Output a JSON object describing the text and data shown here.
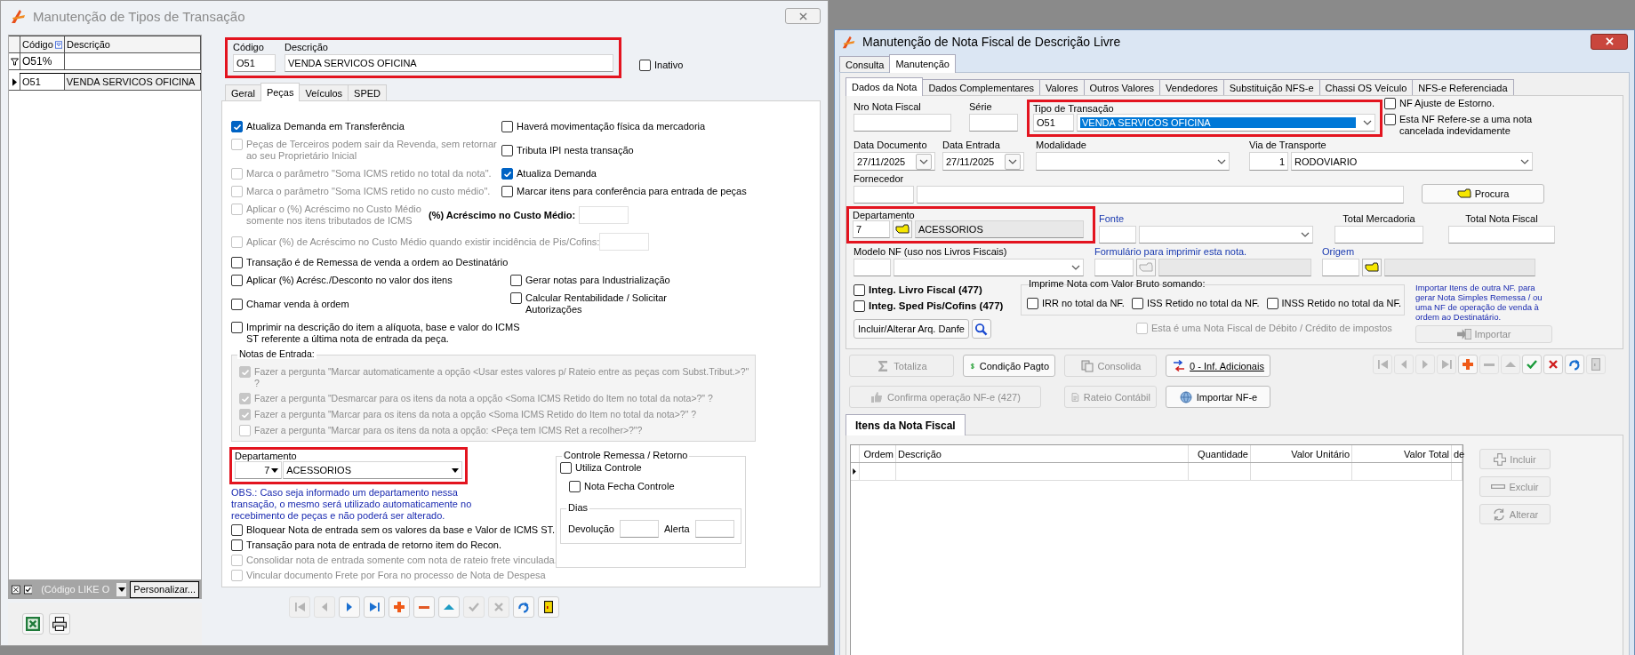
{
  "left_window": {
    "title": "Manutenção de Tipos de Transação",
    "active": false,
    "grid": {
      "columns": [
        "Código",
        "Descrição"
      ],
      "filter_row": [
        "O51%"
      ],
      "rows": [
        {
          "cells": [
            "O51",
            "VENDA SERVICOS OFICINA"
          ],
          "selected": true
        }
      ]
    },
    "filter_bar": {
      "checked": true,
      "text": "(Código LIKE O",
      "button": "Personalizar..."
    },
    "header": {
      "highlighted": true,
      "code_label": "Código",
      "code": "O51",
      "description_label": "Descrição",
      "description": "VENDA SERVICOS OFICINA"
    },
    "inativo": {
      "label": "Inativo",
      "checked": false
    },
    "tabs": [
      {
        "label": "Geral",
        "selected": false
      },
      {
        "label": "Peças",
        "selected": true
      },
      {
        "label": "Veículos",
        "selected": false
      },
      {
        "label": "SPED",
        "selected": false
      }
    ],
    "rows": [
      {
        "kind": "pair",
        "left": {
          "label": "Atualiza Demanda em Transferência",
          "checked": true,
          "disabled": false
        },
        "right": {
          "label": "Haverá movimentação física da mercadoria",
          "checked": false,
          "disabled": false
        }
      },
      {
        "kind": "pair",
        "left": {
          "label": "Peças de Terceiros podem sair da Revenda, sem retornar ao seu Proprietário Inicial",
          "checked": false,
          "disabled": true
        },
        "right": {
          "label": "Tributa IPI nesta transação",
          "checked": false,
          "disabled": false
        }
      },
      {
        "kind": "pair",
        "left": {
          "label": "Marca o parâmetro \"Soma ICMS retido no total da nota\".",
          "checked": false,
          "disabled": true
        },
        "right": {
          "label": "Atualiza Demanda",
          "checked": true,
          "disabled": false
        }
      },
      {
        "kind": "pair",
        "left": {
          "label": "Marca o parâmetro \"Soma ICMS retido no custo médio\".",
          "checked": false,
          "disabled": true
        },
        "right": {
          "label": "Marcar itens para conferência para entrada de peças",
          "checked": false,
          "disabled": false
        }
      },
      {
        "kind": "input",
        "option": {
          "label": "Aplicar o (%) Acréscimo no Custo Médio somente nos itens tributados de ICMS",
          "checked": false,
          "disabled": true
        },
        "input_label": "(%) Acréscimo no Custo Médio:"
      },
      {
        "kind": "input",
        "option": {
          "label": "Aplicar (%) de Acréscimo no Custo Médio quando existir incidência de Pis/Cofins:",
          "checked": false,
          "disabled": true
        }
      },
      {
        "kind": "single",
        "option": {
          "label": "Transação é de Remessa de venda a ordem ao Destinatário",
          "checked": false,
          "disabled": false
        }
      },
      {
        "kind": "pair2",
        "left": {
          "label": "Aplicar (%) Acrésc./Desconto no valor dos itens",
          "checked": false,
          "disabled": false
        },
        "right": {
          "label": "Gerar notas para Industrialização",
          "checked": false,
          "disabled": false
        }
      },
      {
        "kind": "pair2",
        "left": {
          "label": "Chamar venda à ordem",
          "checked": false,
          "disabled": false
        },
        "right": {
          "label": "Calcular Rentabilidade / Solicitar Autorizações",
          "checked": false,
          "disabled": false
        }
      },
      {
        "kind": "single",
        "option": {
          "label": "Imprimir na descrição do item a alíquota, base e valor do ICMS ST referente a última nota de entrada da peça.",
          "checked": false,
          "disabled": false
        }
      }
    ],
    "notas_entrada": {
      "title": "Notas de Entrada:",
      "items": [
        {
          "label": "Fazer a pergunta \"Marcar automaticamente a opção <Usar estes valores p/ Rateio entre as peças com Subst.Tribut.>?\" ?",
          "checked": true,
          "disabled": true
        },
        {
          "label": "Fazer a pergunta \"Desmarcar para os itens da nota a opção <Soma ICMS Retido do Item no total da nota>?\" ?",
          "checked": true,
          "disabled": true
        },
        {
          "label": "Fazer a pergunta \"Marcar para os itens da nota a opção <Soma ICMS Retido do Item no total da nota>?\" ?",
          "checked": true,
          "disabled": true
        },
        {
          "label": "Fazer a pergunta \"Marcar para os itens da nota a opção: <Peça tem ICMS Ret a recolher>?\"?",
          "checked": false,
          "disabled": true
        }
      ]
    },
    "departamento": {
      "highlighted": true,
      "label": "Departamento",
      "code": "7",
      "name": "ACESSORIOS",
      "note": "OBS.: Caso seja informado um departamento nessa transação, o mesmo será utilizado automaticamente no recebimento de peças e não poderá ser alterado."
    },
    "bottom_options": [
      {
        "label": "Bloquear Nota de entrada sem os valores da base e Valor de ICMS ST.",
        "checked": false,
        "disabled": false
      },
      {
        "label": "Transação para nota de entrada de retorno item do Recon.",
        "checked": false,
        "disabled": false
      },
      {
        "label": "Consolidar nota de entrada somente com nota de rateio frete vinculada.",
        "checked": false,
        "disabled": true
      },
      {
        "label": "Vincular documento Frete por Fora no processo de Nota de Despesa",
        "checked": false,
        "disabled": true
      }
    ],
    "controle": {
      "title": "Controle Remessa / Retorno",
      "items": [
        {
          "label": "Utiliza Controle",
          "checked": false
        },
        {
          "label": "Nota Fecha Controle",
          "checked": false
        }
      ],
      "dias": {
        "title": "Dias",
        "fields": [
          {
            "label": "Devolução"
          },
          {
            "label": "Alerta"
          }
        ]
      }
    },
    "nav": [
      {
        "kind": "first",
        "disabled": true
      },
      {
        "kind": "prev",
        "disabled": true
      },
      {
        "kind": "next",
        "disabled": false
      },
      {
        "kind": "last",
        "disabled": false
      },
      {
        "kind": "add",
        "disabled": false
      },
      {
        "kind": "remove",
        "disabled": false
      },
      {
        "kind": "up",
        "disabled": false
      },
      {
        "kind": "confirm",
        "disabled": true
      },
      {
        "kind": "cancel",
        "disabled": true
      },
      {
        "kind": "refresh",
        "disabled": false
      },
      {
        "kind": "exit",
        "disabled": false
      }
    ]
  },
  "right_window": {
    "title": "Manutenção de Nota Fiscal de Descrição Livre",
    "active": true,
    "top_tabs": [
      {
        "label": "Consulta",
        "selected": false
      },
      {
        "label": "Manutenção",
        "selected": true
      }
    ],
    "tabs": [
      {
        "label": "Dados da Nota",
        "selected": true
      },
      {
        "label": "Dados Complementares",
        "selected": false
      },
      {
        "label": "Valores",
        "selected": false
      },
      {
        "label": "Outros Valores",
        "selected": false
      },
      {
        "label": "Vendedores",
        "selected": false
      },
      {
        "label": "Substituição NFS-e",
        "selected": false
      },
      {
        "label": "Chassi OS Veículo",
        "selected": false
      },
      {
        "label": "NFS-e Referenciada",
        "selected": false
      }
    ],
    "nro_nota": {
      "label": "Nro Nota Fiscal"
    },
    "serie": {
      "label": "Série"
    },
    "tipo_transacao": {
      "label": "Tipo de Transação",
      "code": "O51",
      "value": "VENDA SERVICOS OFICINA",
      "highlighted": true
    },
    "flags": [
      {
        "label": "NF Ajuste de Estorno.",
        "checked": false
      },
      {
        "label": "Esta NF Refere-se a uma nota cancelada indevidamente",
        "checked": false
      }
    ],
    "data_documento": {
      "label": "Data Documento",
      "value": "27/11/2025"
    },
    "data_entrada": {
      "label": "Data Entrada",
      "value": "27/11/2025"
    },
    "modalidade": {
      "label": "Modalidade"
    },
    "via_transporte": {
      "label": "Via de Transporte",
      "code": "1",
      "value": "RODOVIARIO"
    },
    "fornecedor": {
      "label": "Fornecedor"
    },
    "procura_button": "Procura",
    "departamento": {
      "highlighted": true,
      "label": "Departamento",
      "code": "7",
      "name": "ACESSORIOS"
    },
    "fonte": {
      "label": "Fonte"
    },
    "total_mercadoria": {
      "label": "Total Mercadoria"
    },
    "total_nota": {
      "label": "Total Nota Fiscal"
    },
    "modelo_nf": {
      "label": "Modelo NF (uso nos Livros Fiscais)"
    },
    "formulario": {
      "label": "Formulário para imprimir esta nota."
    },
    "origem": {
      "label": "Origem"
    },
    "integ": [
      {
        "label": "Integ. Livro Fiscal (477)",
        "checked": false
      },
      {
        "label": "Integ. Sped Pis/Cofins (477)",
        "checked": false
      }
    ],
    "valor_bruto": {
      "title": "Imprime Nota com Valor Bruto somando:",
      "items": [
        {
          "label": "IRR no total da NF.",
          "checked": false
        },
        {
          "label": "ISS Retido no total da NF.",
          "checked": false
        },
        {
          "label": "INSS Retido no total da NF.",
          "checked": false
        }
      ]
    },
    "import_note": "Importar Itens de outra NF. para gerar Nota Simples Remessa / ou uma NF de operação de venda à ordem ao Destinatário.",
    "danfe_button": "Incluir/Alterar Arq. Danfe",
    "debito": {
      "label": "Esta é uma Nota Fiscal de Débito / Crédito de impostos",
      "checked": false,
      "disabled": true
    },
    "importar_button": {
      "label": "Importar",
      "disabled": true
    },
    "actions": [
      {
        "kind": "sum",
        "label": "Totaliza",
        "disabled": true
      },
      {
        "kind": "money",
        "label": "Condição Pagto",
        "disabled": false
      },
      {
        "kind": "merge",
        "label": "Consolida",
        "disabled": true
      },
      {
        "kind": "info",
        "label": "0 - Inf. Adicionais",
        "disabled": false
      },
      {
        "kind": "thumb",
        "label": "Confirma operação NF-e (427)",
        "disabled": true
      },
      {
        "kind": "doc",
        "label": "Rateio Contábil",
        "disabled": true
      },
      {
        "kind": "import",
        "label": "Importar NF-e",
        "disabled": false
      }
    ],
    "nav": [
      {
        "kind": "first",
        "disabled": true
      },
      {
        "kind": "prev",
        "disabled": true
      },
      {
        "kind": "next",
        "disabled": true
      },
      {
        "kind": "last",
        "disabled": true
      },
      {
        "kind": "add",
        "disabled": false
      },
      {
        "kind": "remove",
        "disabled": true
      },
      {
        "kind": "up",
        "disabled": true
      },
      {
        "kind": "confirm",
        "disabled": false
      },
      {
        "kind": "cancel",
        "disabled": false
      },
      {
        "kind": "refresh",
        "disabled": false
      },
      {
        "kind": "exit",
        "disabled": true
      }
    ],
    "items_tab": "Itens da Nota Fiscal",
    "items_columns": [
      "Ordem",
      "Descrição",
      "Quantidade",
      "Valor Unitário",
      "Valor Total",
      "de"
    ],
    "item_buttons": [
      {
        "kind": "add",
        "label": "Incluir",
        "disabled": true
      },
      {
        "kind": "remove",
        "label": "Excluir",
        "disabled": true
      },
      {
        "kind": "refresh",
        "label": "Alterar",
        "disabled": true
      }
    ]
  }
}
